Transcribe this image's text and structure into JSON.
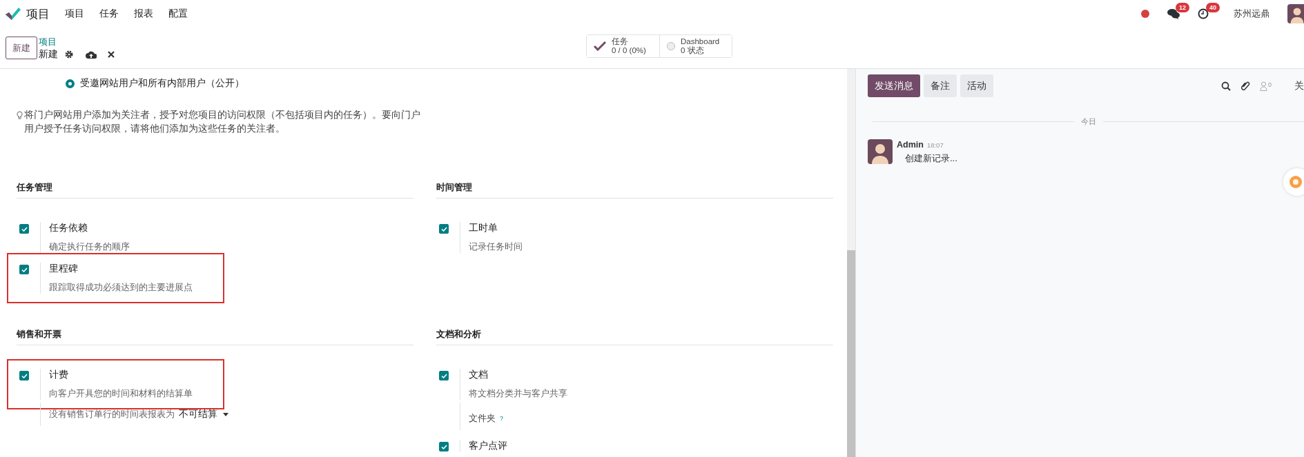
{
  "app": {
    "name": "项目"
  },
  "menu": [
    {
      "label": "项目"
    },
    {
      "label": "任务"
    },
    {
      "label": "报表"
    },
    {
      "label": "配置"
    }
  ],
  "systray": {
    "chat_count": "12",
    "activity_count": "40",
    "company": "苏州远鼎"
  },
  "control_panel": {
    "new_button": "新建",
    "breadcrumb": "项目",
    "record": "新建",
    "smart_buttons": [
      {
        "kind": "tasks",
        "label": "任务",
        "value": "0 / 0 (0%)"
      },
      {
        "kind": "dashboard",
        "label": "Dashboard",
        "value": "0 状态"
      }
    ]
  },
  "privacy": {
    "option": {
      "label": "受邀网站用户和所有内部用户（公开）",
      "selected": true
    },
    "hint": "将门户网站用户添加为关注者，授予对您项目的访问权限（不包括项目内的任务）。要向门户用户授予任务访问权限，请将他们添加为这些任务的关注者。"
  },
  "sections": [
    {
      "title": "任务管理",
      "settings": [
        {
          "label": "任务依赖",
          "description": "确定执行任务的顺序",
          "checked": true,
          "highlighted": false
        },
        {
          "label": "里程碑",
          "description": "跟踪取得成功必须达到的主要进展点",
          "checked": true,
          "highlighted": true
        }
      ]
    },
    {
      "title": "时间管理",
      "settings": [
        {
          "label": "工时单",
          "description": "记录任务时间",
          "checked": true,
          "highlighted": false
        }
      ]
    },
    {
      "title": "销售和开票",
      "settings": [
        {
          "label": "计费",
          "description": "向客户开具您的时间和材料的结算单",
          "checked": true,
          "highlighted": true,
          "extras": [
            {
              "kind": "dropdown",
              "label": "没有销售订单行的时间表报表为",
              "value": "不可结算"
            }
          ]
        }
      ]
    },
    {
      "title": "文档和分析",
      "settings": [
        {
          "label": "文档",
          "description": "将文档分类并与客户共享",
          "checked": true,
          "highlighted": false,
          "extras": [
            {
              "kind": "help_field",
              "label": "文件夹",
              "help": "?"
            }
          ]
        },
        {
          "label": "客户点评",
          "checked": true,
          "highlighted": false
        }
      ]
    }
  ],
  "chatter": {
    "buttons": [
      {
        "label": "发送消息",
        "selected": true
      },
      {
        "label": "备注",
        "selected": false
      },
      {
        "label": "活动",
        "selected": false
      }
    ],
    "follower_count": "0",
    "follow": "关",
    "date_separator": "今日",
    "messages": [
      {
        "author": "Admin",
        "time": "18:07",
        "body": "创建新记录..."
      }
    ]
  }
}
